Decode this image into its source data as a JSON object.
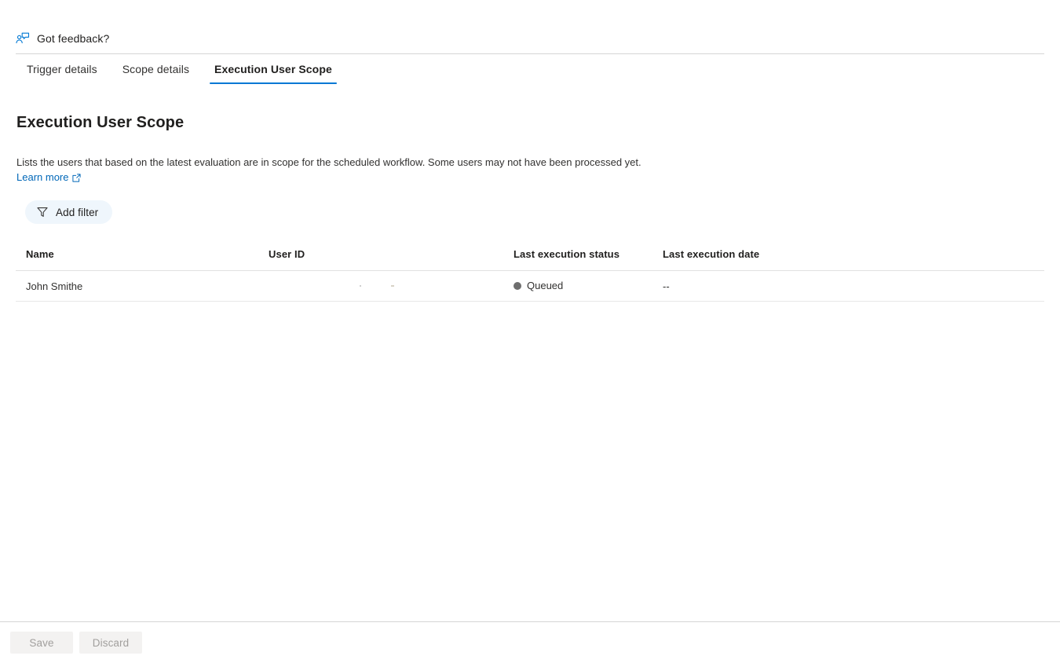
{
  "feedback": {
    "label": "Got feedback?",
    "icon": "feedback-person-icon",
    "icon_color": "#0078d4"
  },
  "tabs": [
    {
      "label": "Trigger details",
      "active": false
    },
    {
      "label": "Scope details",
      "active": false
    },
    {
      "label": "Execution User Scope",
      "active": true
    }
  ],
  "main": {
    "title": "Execution User Scope",
    "description": "Lists the users that based on the latest evaluation are in scope for the scheduled workflow. Some users may not have been processed yet.",
    "learn_more_label": "Learn more",
    "learn_more_icon": "external-link-icon",
    "add_filter_label": "Add filter",
    "add_filter_icon": "funnel-icon"
  },
  "table": {
    "columns": [
      "Name",
      "User ID",
      "Last execution status",
      "Last execution date"
    ],
    "rows": [
      {
        "name": "John Smithe",
        "user_id": "",
        "last_execution_status": "Queued",
        "status_dot_color": "#6e6e6e",
        "last_execution_date": "--"
      }
    ]
  },
  "bottom_bar": {
    "save_label": "Save",
    "discard_label": "Discard"
  },
  "colors": {
    "accent": "#0078d4",
    "link": "#0067b8",
    "pill_bg": "#eff6fc",
    "divider": "#d6d6d6",
    "disabled_btn_bg": "#f3f2f1",
    "disabled_btn_text": "#a19f9d"
  }
}
